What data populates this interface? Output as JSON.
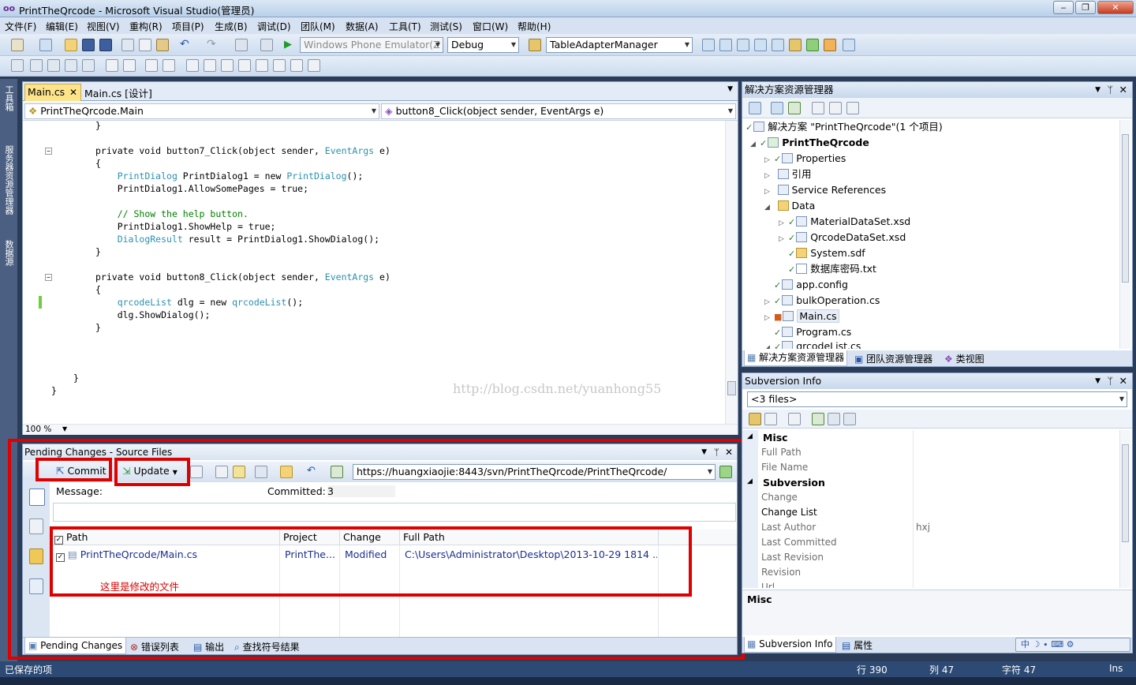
{
  "window": {
    "title": "PrintTheQrcode - Microsoft Visual Studio(管理员)",
    "logo": "oo"
  },
  "menu": [
    "文件(F)",
    "编辑(E)",
    "视图(V)",
    "重构(R)",
    "项目(P)",
    "生成(B)",
    "调试(D)",
    "团队(M)",
    "数据(A)",
    "工具(T)",
    "测试(S)",
    "窗口(W)",
    "帮助(H)"
  ],
  "toolbar": {
    "target": "Windows Phone Emulator(Z",
    "config": "Debug",
    "find": "TableAdapterManager"
  },
  "left_tool": {
    "toolbox": "工具箱",
    "server_explorer": "服务器资源管理器",
    "data_sources": "数据源"
  },
  "editor": {
    "tabs": [
      {
        "label": "Main.cs",
        "active": true
      },
      {
        "label": "Main.cs [设计]"
      }
    ],
    "nav_left": "PrintTheQrcode.Main",
    "nav_right": "button8_Click(object sender, EventArgs e)",
    "zoom": "100 %",
    "watermark": "http://blog.csdn.net/yuanhong55"
  },
  "pending": {
    "title": "Pending Changes - Source Files",
    "commit_label": "Commit",
    "update_label": "Update",
    "url": "https://huangxiaojie:8443/svn/PrintTheQrcode/PrintTheQrcode/",
    "message_label": "Message:",
    "committed_label": "Committed:",
    "committed_value": "3",
    "columns": [
      "Path",
      "Project",
      "Change",
      "Full Path"
    ],
    "row": {
      "path": "PrintTheQrcode/Main.cs",
      "project": "PrintThe...",
      "change": "Modified",
      "full_path": "C:\\Users\\Administrator\\Desktop\\2013-10-29 1814 ..."
    },
    "annotation": "这里是修改的文件",
    "bottom_tabs": [
      "Pending Changes",
      "错误列表",
      "输出",
      "查找符号结果"
    ]
  },
  "solution": {
    "title": "解决方案资源管理器",
    "items": [
      {
        "label": "解决方案 \"PrintTheQrcode\"(1 个项目)"
      },
      {
        "label": "PrintTheQrcode"
      },
      {
        "label": "Properties"
      },
      {
        "label": "引用"
      },
      {
        "label": "Service References"
      },
      {
        "label": "Data"
      },
      {
        "label": "MaterialDataSet.xsd"
      },
      {
        "label": "QrcodeDataSet.xsd"
      },
      {
        "label": "System.sdf"
      },
      {
        "label": "数据库密码.txt"
      },
      {
        "label": "app.config"
      },
      {
        "label": "bulkOperation.cs"
      },
      {
        "label": "Main.cs"
      },
      {
        "label": "Program.cs"
      },
      {
        "label": "qrcodeList.cs"
      }
    ],
    "tabs": [
      "解决方案资源管理器",
      "团队资源管理器",
      "类视图"
    ]
  },
  "svninfo": {
    "title": "Subversion Info",
    "selector": "<3 files>",
    "cat_misc": "Misc",
    "cat_subversion": "Subversion",
    "full_path": "Full Path",
    "file_name": "File Name",
    "change": "Change",
    "change_list": "Change List",
    "last_author": "Last Author",
    "last_author_value": "hxj",
    "last_committed": "Last Committed",
    "last_revision": "Last Revision",
    "revision": "Revision",
    "url": "Url",
    "desc": "Misc",
    "tabs": [
      "Subversion Info",
      "属性"
    ]
  },
  "status": {
    "left": "已保存的项",
    "line": "行 390",
    "col": "列 47",
    "char": "字符 47",
    "mode": "Ins"
  },
  "ime": {
    "lang": "中"
  }
}
